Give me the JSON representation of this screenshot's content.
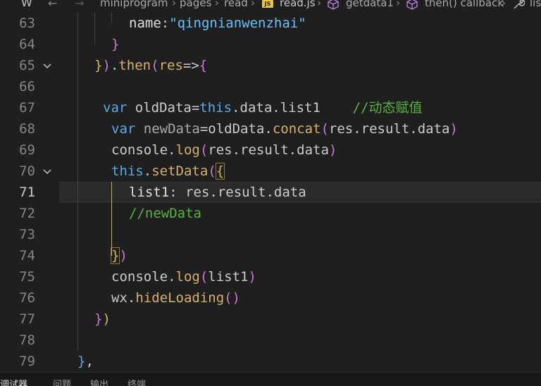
{
  "breadcrumb": {
    "items": [
      "miniprogram",
      "pages",
      "read",
      "read.js",
      "getdata1",
      "then() callback",
      "lis"
    ],
    "file_badge": "JS"
  },
  "editor": {
    "lines": [
      {
        "num": "63",
        "text": "name:\"qingnianwenzhai\""
      },
      {
        "num": "64",
        "text": "}"
      },
      {
        "num": "65",
        "text": "}).then(res=>{"
      },
      {
        "num": "66",
        "text": ""
      },
      {
        "num": "67",
        "text": "var oldData=this.data.list1    //动态赋值"
      },
      {
        "num": "68",
        "text": "var newData=oldData.concat(res.result.data)"
      },
      {
        "num": "69",
        "text": "console.log(res.result.data)"
      },
      {
        "num": "70",
        "text": "this.setData({"
      },
      {
        "num": "71",
        "text": "list1: res.result.data"
      },
      {
        "num": "72",
        "text": "//newData"
      },
      {
        "num": "73",
        "text": ""
      },
      {
        "num": "74",
        "text": "})"
      },
      {
        "num": "75",
        "text": "console.log(list1)"
      },
      {
        "num": "76",
        "text": "wx.hideLoading()"
      },
      {
        "num": "77",
        "text": "})"
      },
      {
        "num": "78",
        "text": ""
      },
      {
        "num": "79",
        "text": "},"
      }
    ],
    "current_line": "71"
  },
  "bottom_panel": {
    "tabs": [
      "调试器",
      "问题",
      "输出",
      "终端"
    ],
    "active_tab": "调试器"
  },
  "colors": {
    "background": "#1f1f1f",
    "string": "#66c2ff",
    "keyword": "#5aa9f0",
    "method": "#d9b06b",
    "comment": "#56b43c",
    "bracket_gold": "#d7b85a",
    "bracket_purple": "#cc77d6"
  }
}
